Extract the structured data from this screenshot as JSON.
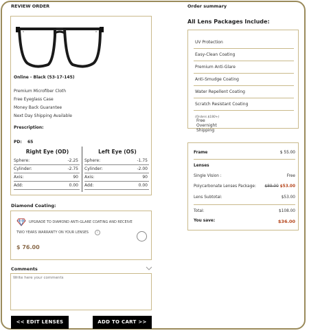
{
  "review": {
    "title": "REVIEW ORDER",
    "product_name": "Online - Black (53-17-145)",
    "includes": [
      "Premium Microfiber Cloth",
      "Free Eyeglass Case",
      "Money Back Guarantee",
      "Next Day Shipping Available"
    ],
    "prescription_label": "Prescription:",
    "pd_label": "PD:",
    "pd_value": "65",
    "right_eye": {
      "title": "Right Eye (OD)",
      "rows": [
        {
          "label": "Sphere:",
          "value": "-2.25"
        },
        {
          "label": "Cylinder:",
          "value": "-2.75"
        },
        {
          "label": "Axis:",
          "value": "90"
        },
        {
          "label": "Add:",
          "value": "0.00"
        }
      ]
    },
    "left_eye": {
      "title": "Left Eye (OS)",
      "rows": [
        {
          "label": "Sphere:",
          "value": "-1.75"
        },
        {
          "label": "Cylinder:",
          "value": "-2.00"
        },
        {
          "label": "Axis:",
          "value": "90"
        },
        {
          "label": "Add:",
          "value": "0.00"
        }
      ]
    }
  },
  "diamond": {
    "title": "Diamond Coating:",
    "line1": "UPGRADE TO DIAMOND ANTI-GLARE COATING AND RECEIVE",
    "line2": "TWO YEARS WARRANTY ON YOUR LENSES",
    "price": "$ 76.00",
    "info_icon_glyph": "i"
  },
  "comments": {
    "title": "Comments",
    "placeholder": "Write here your comments"
  },
  "buttons": {
    "edit": "<< EDIT LENSES",
    "cart": "ADD TO CART >>"
  },
  "summary": {
    "title": "Order summary",
    "packages_title": "All Lens Packages Include:",
    "packages": [
      "UV Protection",
      "Easy-Clean Coating",
      "Premium Anti-Glare",
      "Anti-Smudge Coating",
      "Water Repellent Coating",
      "Scratch Resistant Coating",
      "Free Overnight Shipping"
    ],
    "shipping_note": "(Orders $180+)",
    "frame_label": "Frame",
    "frame_price": "$ 55.00",
    "lenses_label": "Lenses",
    "single_vision_label": "Single Vision :",
    "single_vision_price": "Free",
    "poly_label": "Polycarbonate Lenses Package:",
    "poly_old_price": "$89.00",
    "poly_price": "$53.00",
    "lens_subtotal_label": "Lens Subtotal:",
    "lens_subtotal": "$53.00",
    "total_label": "Total:",
    "total": "$108.00",
    "save_label": "You save:",
    "save": "$36.00"
  },
  "colors": {
    "accent": "#c9b98a",
    "price_red": "#b5461c",
    "price_brown": "#8a6a4a"
  }
}
